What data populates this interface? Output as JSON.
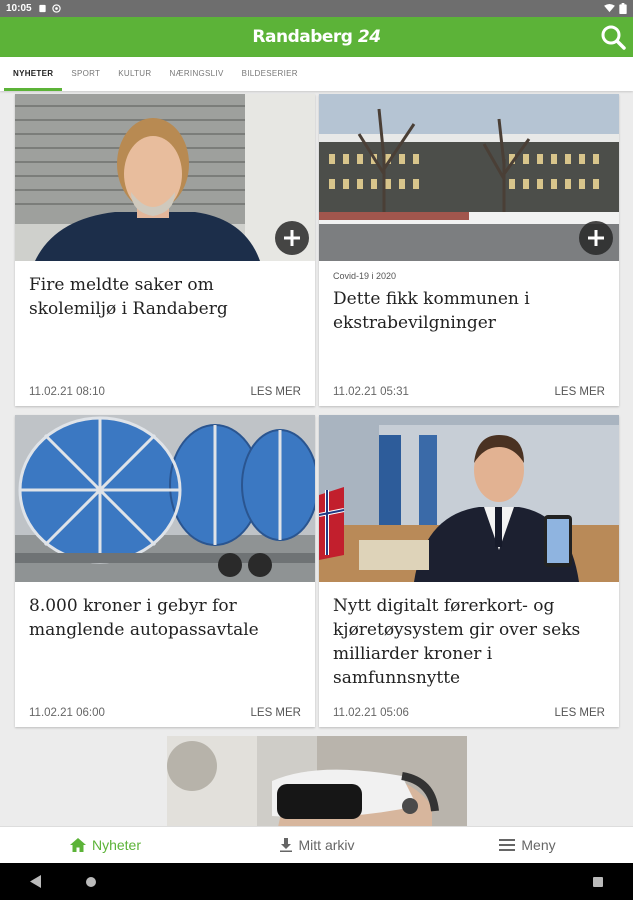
{
  "status": {
    "time": "10:05"
  },
  "app": {
    "brand_name": "Randaberg",
    "brand_number": "24"
  },
  "tabs": [
    {
      "label": "NYHETER",
      "active": true
    },
    {
      "label": "SPORT"
    },
    {
      "label": "KULTUR"
    },
    {
      "label": "NÆRINGSLIV"
    },
    {
      "label": "BILDESERIER"
    }
  ],
  "articles": [
    {
      "tag": "",
      "title": "Fire meldte saker om skolemiljø i Randaberg",
      "date": "11.02.21 08:10",
      "more": "LES MER",
      "image": "man-portrait"
    },
    {
      "tag": "Covid-19 i 2020",
      "title": "Dette fikk kommunen i ekstrabevilgninger",
      "date": "11.02.21 05:31",
      "more": "LES MER",
      "image": "municipal-building"
    },
    {
      "tag": "",
      "title": "8.000 kroner i gebyr for manglende autopassavtale",
      "date": "11.02.21 06:00",
      "more": "LES MER",
      "image": "cable-drums-on-trailer"
    },
    {
      "tag": "",
      "title": "Nytt digitalt førerkort- og kjøretøysystem gir over seks milliarder kroner i samfunnsnytte",
      "date": "11.02.21 05:06",
      "more": "LES MER",
      "image": "man-with-phone"
    }
  ],
  "bottom_nav": [
    {
      "label": "Nyheter",
      "icon": "home-icon",
      "active": true
    },
    {
      "label": "Mitt arkiv",
      "icon": "download-icon"
    },
    {
      "label": "Meny",
      "icon": "menu-icon"
    }
  ],
  "colors": {
    "brand_green": "#5cb338",
    "status_bar": "#6e6e6e"
  }
}
